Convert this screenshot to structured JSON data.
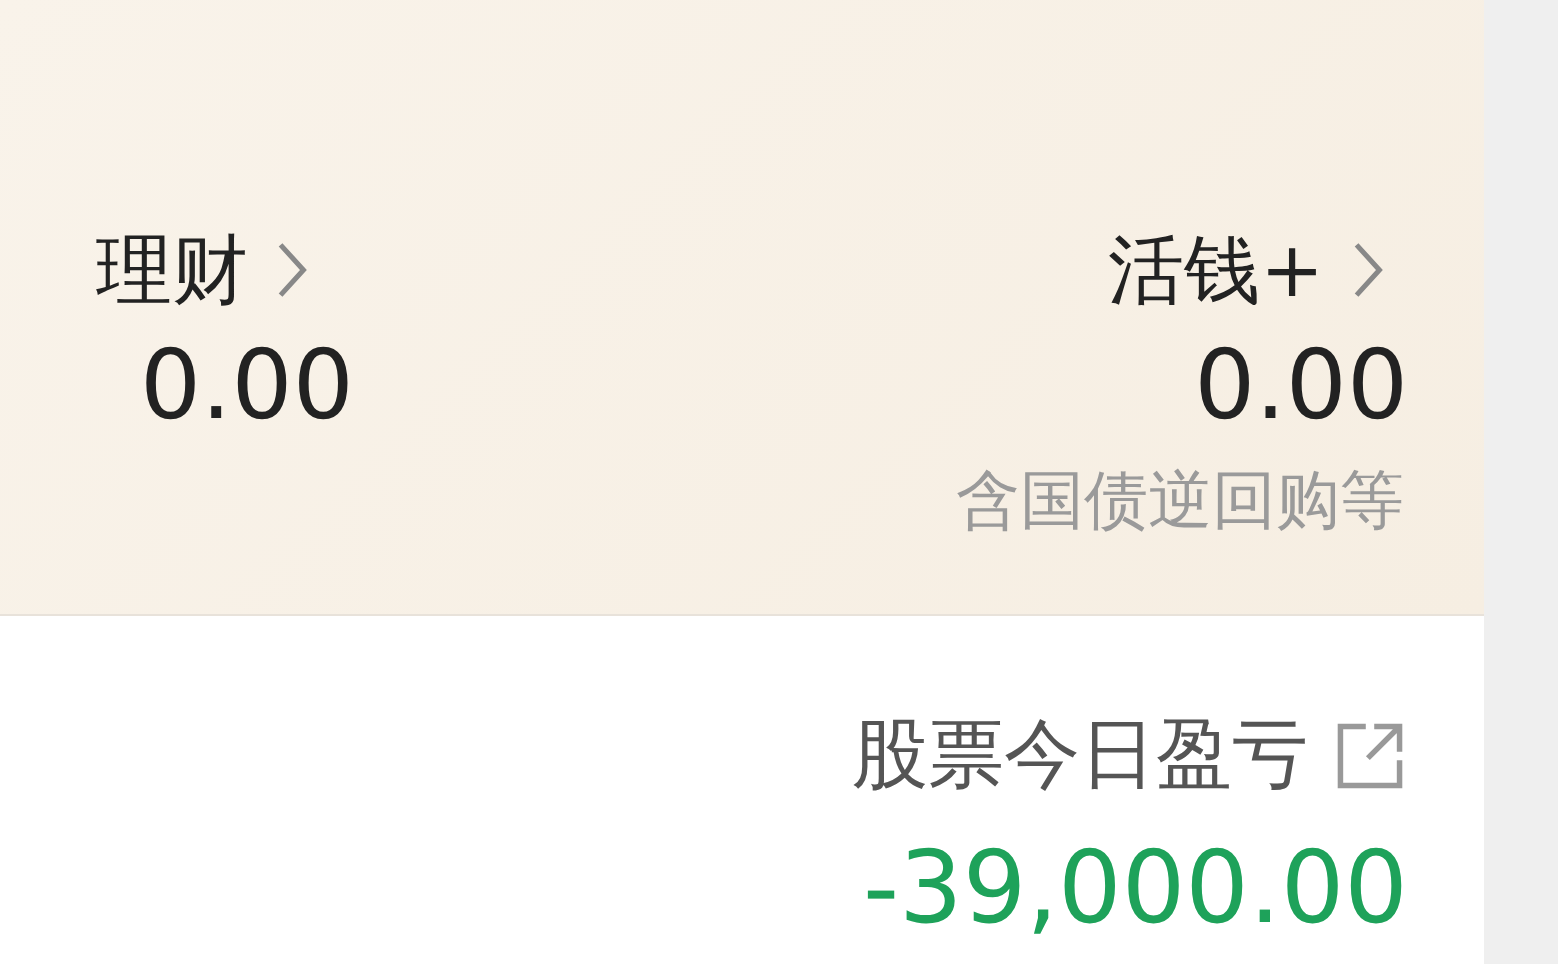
{
  "assets": [
    {
      "label": "理财",
      "value": "0.00"
    },
    {
      "label": "活钱+",
      "value": "0.00",
      "note": "含国债逆回购等"
    }
  ],
  "stock_pnl": {
    "label": "股票今日盈亏",
    "value": "-39,000.00"
  }
}
